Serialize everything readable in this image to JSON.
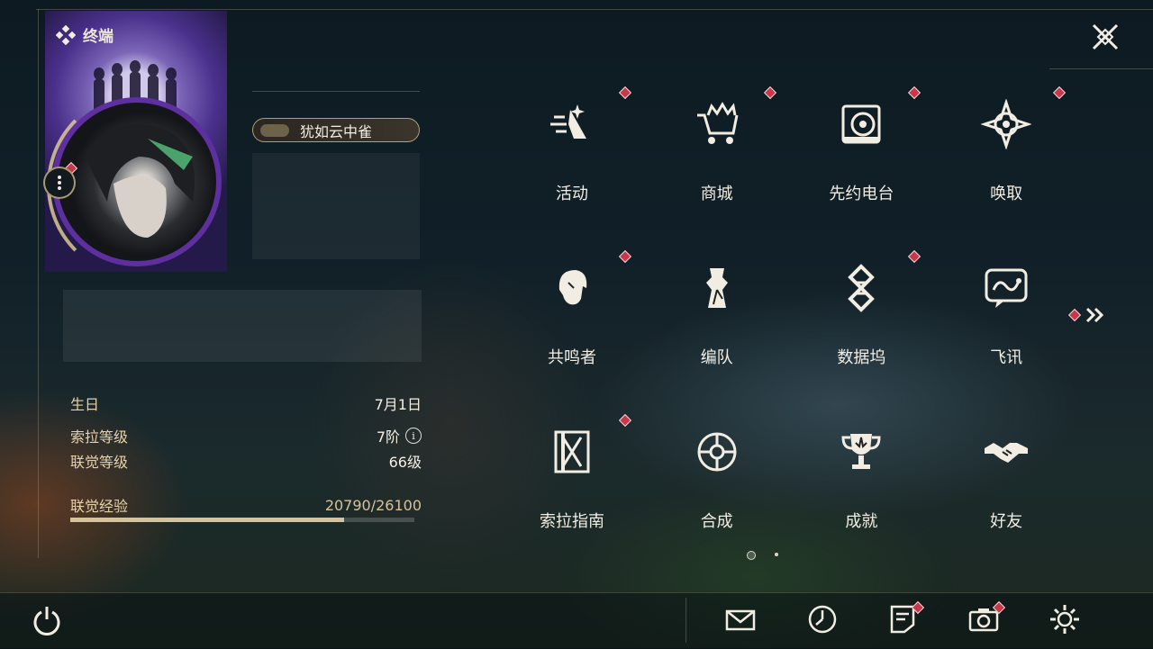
{
  "header": {
    "section_title": "终端",
    "close_icon": "close-icon"
  },
  "profile": {
    "name": "犹如云中雀",
    "stats": [
      {
        "label": "生日",
        "value": "7月1日"
      },
      {
        "label": "索拉等级",
        "value": "7阶"
      },
      {
        "label": "联觉等级",
        "value": "66级"
      }
    ],
    "exp": {
      "label": "联觉经验",
      "value": "20790/26100",
      "current": 20790,
      "max": 26100
    }
  },
  "menu": {
    "items": [
      {
        "label": "活动",
        "icon": "event-icon",
        "badge": true
      },
      {
        "label": "商城",
        "icon": "shop-icon",
        "badge": true
      },
      {
        "label": "先约电台",
        "icon": "radio-icon",
        "badge": true
      },
      {
        "label": "唤取",
        "icon": "convene-icon",
        "badge": true
      },
      {
        "label": "共鸣者",
        "icon": "resonator-icon",
        "badge": true
      },
      {
        "label": "编队",
        "icon": "team-icon",
        "badge": false
      },
      {
        "label": "数据坞",
        "icon": "databank-icon",
        "badge": true
      },
      {
        "label": "飞讯",
        "icon": "message-icon",
        "badge": false
      },
      {
        "label": "索拉指南",
        "icon": "guidebook-icon",
        "badge": true
      },
      {
        "label": "合成",
        "icon": "synthesis-icon",
        "badge": false
      },
      {
        "label": "成就",
        "icon": "trophy-icon",
        "badge": false
      },
      {
        "label": "好友",
        "icon": "friends-icon",
        "badge": false
      }
    ],
    "pages": 2,
    "active_page": 1
  },
  "bottom": {
    "buttons": [
      {
        "icon": "power-icon",
        "badge": false
      },
      {
        "icon": "mail-icon",
        "badge": false
      },
      {
        "icon": "clock-icon",
        "badge": false
      },
      {
        "icon": "notice-icon",
        "badge": true
      },
      {
        "icon": "camera-icon",
        "badge": true
      },
      {
        "icon": "settings-icon",
        "badge": false
      }
    ]
  },
  "colors": {
    "accent": "#e6d2a8",
    "badge": "#c8374a",
    "exp_fill": "#d7c39a"
  }
}
